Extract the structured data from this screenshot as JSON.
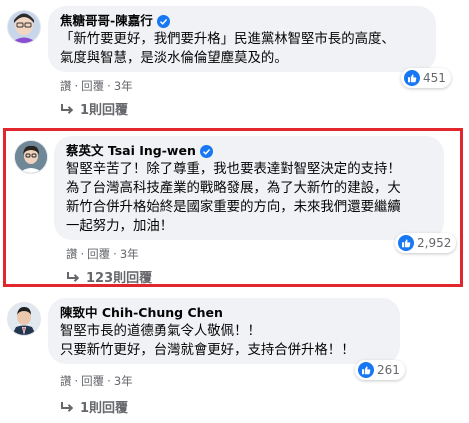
{
  "colors": {
    "bubble": "#f0f2f5",
    "meta_text": "#65676b",
    "verified_blue": "#1877f2",
    "like_blue": "#1877f2",
    "highlight_red": "#e1262d"
  },
  "comments": [
    {
      "author": "焦糖哥哥-陳嘉行",
      "verified": true,
      "lines": [
        "「新竹要更好，我們要升格」民進黨林智堅市長的高度、",
        "氣度與智慧，是淡水倫倫望塵莫及的。"
      ],
      "reaction_icon": "like-icon",
      "reaction_count": "451",
      "actions": [
        "讚",
        "回覆",
        "3年"
      ],
      "replies": "1則回覆"
    },
    {
      "author": "蔡英文 Tsai Ing-wen",
      "verified": true,
      "lines": [
        "智堅辛苦了！除了尊重，我也要表達對智堅決定的支持！",
        "為了台灣高科技產業的戰略發展，為了大新竹的建設，大",
        "新竹合併升格始終是國家重要的方向，未來我們還要繼續",
        "一起努力，加油！"
      ],
      "reaction_icon": "like-icon",
      "reaction_count": "2,952",
      "actions": [
        "讚",
        "回覆",
        "3年"
      ],
      "replies": "123則回覆"
    },
    {
      "author": "陳致中 Chih-Chung Chen",
      "verified": false,
      "lines": [
        "智堅市長的道德勇氣令人敬佩！！",
        "只要新竹更好，台灣就會更好，支持合併升格！！"
      ],
      "reaction_icon": "like-icon",
      "reaction_count": "261",
      "actions": [
        "讚",
        "回覆",
        "3年"
      ],
      "replies": "1則回覆"
    }
  ]
}
